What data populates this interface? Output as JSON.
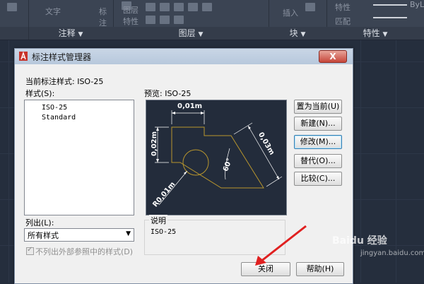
{
  "ribbon": {
    "groups": [
      {
        "label": "注释",
        "items": [
          "文字",
          "标注"
        ]
      },
      {
        "label": "图层",
        "items": [
          "图层",
          "特性"
        ]
      },
      {
        "label": "块",
        "items": [
          "插入"
        ]
      },
      {
        "label": "特性",
        "items": [
          "特性",
          "匹配",
          "ByL"
        ]
      }
    ]
  },
  "dialog": {
    "title": "标注样式管理器",
    "close_label": "X",
    "current_style_label": "当前标注样式: ISO-25",
    "styles_label": "样式(S):",
    "styles": [
      "ISO-25",
      "Standard"
    ],
    "preview_label": "预览: ISO-25",
    "list_label": "列出(L):",
    "list_value": "所有样式",
    "xref_checkbox_label": "不列出外部参照中的样式(D)",
    "description_title": "说明",
    "description_value": "ISO-25",
    "buttons": {
      "set_current": "置为当前(U)",
      "new": "新建(N)...",
      "modify": "修改(M)...",
      "override": "替代(O)...",
      "compare": "比较(C)...",
      "close": "关闭",
      "help": "帮助(H)"
    },
    "preview_dims": {
      "width": "0,01m",
      "height": "0,02m",
      "slant": "0,03m",
      "angle": "60°",
      "radius": "R0,01m"
    }
  },
  "watermark": {
    "main": "Baidu 经验",
    "sub": "jingyan.baidu.com"
  },
  "colors": {
    "background": "#232c3b",
    "ribbon": "#3b4453",
    "shape": "#b8962e",
    "dialog": "#f0f0f0",
    "annotation_arrow": "#e02020"
  }
}
